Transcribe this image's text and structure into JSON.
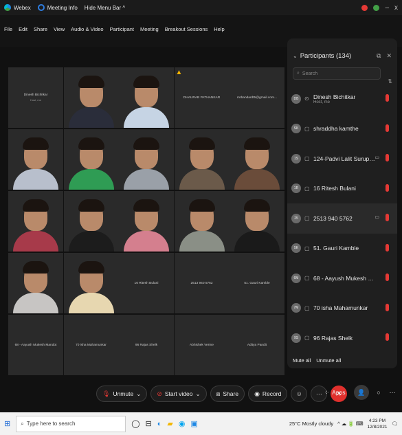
{
  "titlebar": {
    "app": "Webex",
    "meeting_info": "Meeting Info",
    "hide_menu": "Hide Menu Bar ^",
    "minimize": "–",
    "close": "x"
  },
  "menubar": [
    "File",
    "Edit",
    "Share",
    "View",
    "Audio & Video",
    "Participant",
    "Meeting",
    "Breakout Sessions",
    "Help"
  ],
  "grid": {
    "tiles": [
      {
        "name": "Dinesh Bichitkar",
        "sub": "Host, me"
      },
      {
        "name": "",
        "body": "#2a2d3a"
      },
      {
        "name": "",
        "body": "#c6d4e4"
      },
      {
        "name": "DHAURAB PATHANKAR"
      },
      {
        "name": "mrbandardt5@gmail.com..."
      },
      {
        "name": "",
        "body": "#b8bfcc"
      },
      {
        "name": "",
        "body": "#2f9c54"
      },
      {
        "name": "",
        "body": "#9aa0a8"
      },
      {
        "name": "",
        "body": "#6b5a4a"
      },
      {
        "name": "",
        "body": "#6a4c3a"
      },
      {
        "name": "",
        "body": "#a73a4a"
      },
      {
        "name": "",
        "body": "#1c1c1c"
      },
      {
        "name": "",
        "body": "#d47f8e"
      },
      {
        "name": "",
        "body": "#8a8f86"
      },
      {
        "name": "",
        "body": "#1a1a1a"
      },
      {
        "name": "",
        "body": "#c7c5c3"
      },
      {
        "name": "",
        "body": "#e7d7b0"
      },
      {
        "name": "16 Ritesh Bulani"
      },
      {
        "name": "2513 940 5762"
      },
      {
        "name": "51. Gauri Kamble"
      },
      {
        "name": "68 - Aayush Mukesh Mandot"
      },
      {
        "name": "70 isha Mahamunkar"
      },
      {
        "name": "96 Rajas Shelk"
      },
      {
        "name": "Abhishek Verme"
      },
      {
        "name": "Aditya Pandit"
      }
    ]
  },
  "panel": {
    "title": "Participants (134)",
    "search_placeholder": "Search",
    "mute_all": "Mute all",
    "unmute_all": "Unmute all",
    "participants": [
      {
        "initials": "DB",
        "name": "Dinesh Bichitkar",
        "role": "Host, me",
        "video": false
      },
      {
        "initials": "SK",
        "name": "shraddha kamthe",
        "role": "",
        "video": false
      },
      {
        "initials": "1S",
        "name": "124-Padvi Lalit Surups...",
        "role": "",
        "video": true
      },
      {
        "initials": "1R",
        "name": "16 Ritesh Bulani",
        "role": "",
        "video": false
      },
      {
        "initials": "25",
        "name": "2513 940 5762",
        "role": "",
        "video": true
      },
      {
        "initials": "5K",
        "name": "51. Gauri Kamble",
        "role": "",
        "video": false
      },
      {
        "initials": "6M",
        "name": "68 - Aayush Mukesh Mandot",
        "role": "",
        "video": false
      },
      {
        "initials": "7M",
        "name": "70 isha Mahamunkar",
        "role": "",
        "video": false
      },
      {
        "initials": "9S",
        "name": "96 Rajas Shelk",
        "role": "",
        "video": false
      }
    ]
  },
  "controls": {
    "unmute": "Unmute",
    "start_video": "Start video",
    "share": "Share",
    "record": "Record",
    "apps": "Apps"
  },
  "taskbar": {
    "search_placeholder": "Type here to search",
    "weather": "25°C Mostly cloudy",
    "time": "4:23 PM",
    "date": "12/8/2021"
  },
  "colors": {
    "mute_red": "#e53935",
    "end_red": "#e0302d"
  }
}
